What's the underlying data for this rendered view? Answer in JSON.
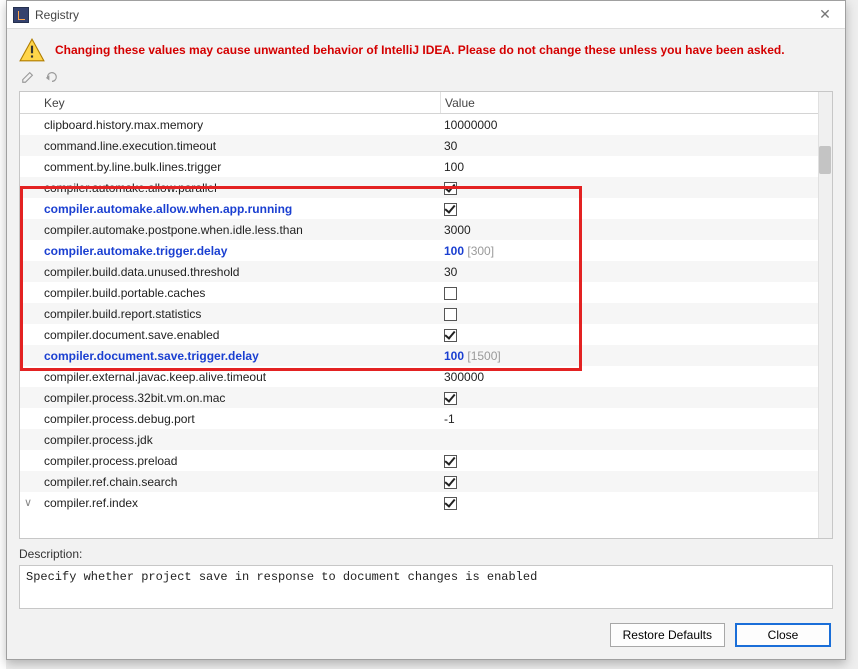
{
  "window": {
    "title": "Registry",
    "close_glyph": "✕"
  },
  "warning": "Changing these values may cause unwanted behavior of IntelliJ IDEA. Please do not change these unless you have been asked.",
  "columns": {
    "key": "Key",
    "value": "Value"
  },
  "rows": [
    {
      "key": "clipboard.history.max.memory",
      "value": "10000000",
      "type": "text",
      "bold": false
    },
    {
      "key": "command.line.execution.timeout",
      "value": "30",
      "type": "text",
      "bold": false
    },
    {
      "key": "comment.by.line.bulk.lines.trigger",
      "value": "100",
      "type": "text",
      "bold": false
    },
    {
      "key": "compiler.automake.allow.parallel",
      "value": true,
      "type": "check",
      "bold": false
    },
    {
      "key": "compiler.automake.allow.when.app.running",
      "value": true,
      "type": "check",
      "bold": true
    },
    {
      "key": "compiler.automake.postpone.when.idle.less.than",
      "value": "3000",
      "type": "text",
      "bold": false
    },
    {
      "key": "compiler.automake.trigger.delay",
      "value": "100",
      "default": "[300]",
      "type": "text",
      "bold": true
    },
    {
      "key": "compiler.build.data.unused.threshold",
      "value": "30",
      "type": "text",
      "bold": false
    },
    {
      "key": "compiler.build.portable.caches",
      "value": false,
      "type": "check",
      "bold": false
    },
    {
      "key": "compiler.build.report.statistics",
      "value": false,
      "type": "check",
      "bold": false
    },
    {
      "key": "compiler.document.save.enabled",
      "value": true,
      "type": "check",
      "bold": false
    },
    {
      "key": "compiler.document.save.trigger.delay",
      "value": "100",
      "default": "[1500]",
      "type": "text",
      "bold": true
    },
    {
      "key": "compiler.external.javac.keep.alive.timeout",
      "value": "300000",
      "type": "text",
      "bold": false
    },
    {
      "key": "compiler.process.32bit.vm.on.mac",
      "value": true,
      "type": "check",
      "bold": false
    },
    {
      "key": "compiler.process.debug.port",
      "value": "-1",
      "type": "text",
      "bold": false
    },
    {
      "key": "compiler.process.jdk",
      "value": "",
      "type": "text",
      "bold": false
    },
    {
      "key": "compiler.process.preload",
      "value": true,
      "type": "check",
      "bold": false
    },
    {
      "key": "compiler.ref.chain.search",
      "value": true,
      "type": "check",
      "bold": false
    },
    {
      "key": "compiler.ref.index",
      "value": true,
      "type": "check",
      "bold": false,
      "expander": "∨"
    }
  ],
  "description": {
    "label": "Description:",
    "text": "Specify whether project save in response to document changes is enabled"
  },
  "buttons": {
    "restore": "Restore Defaults",
    "close": "Close"
  }
}
